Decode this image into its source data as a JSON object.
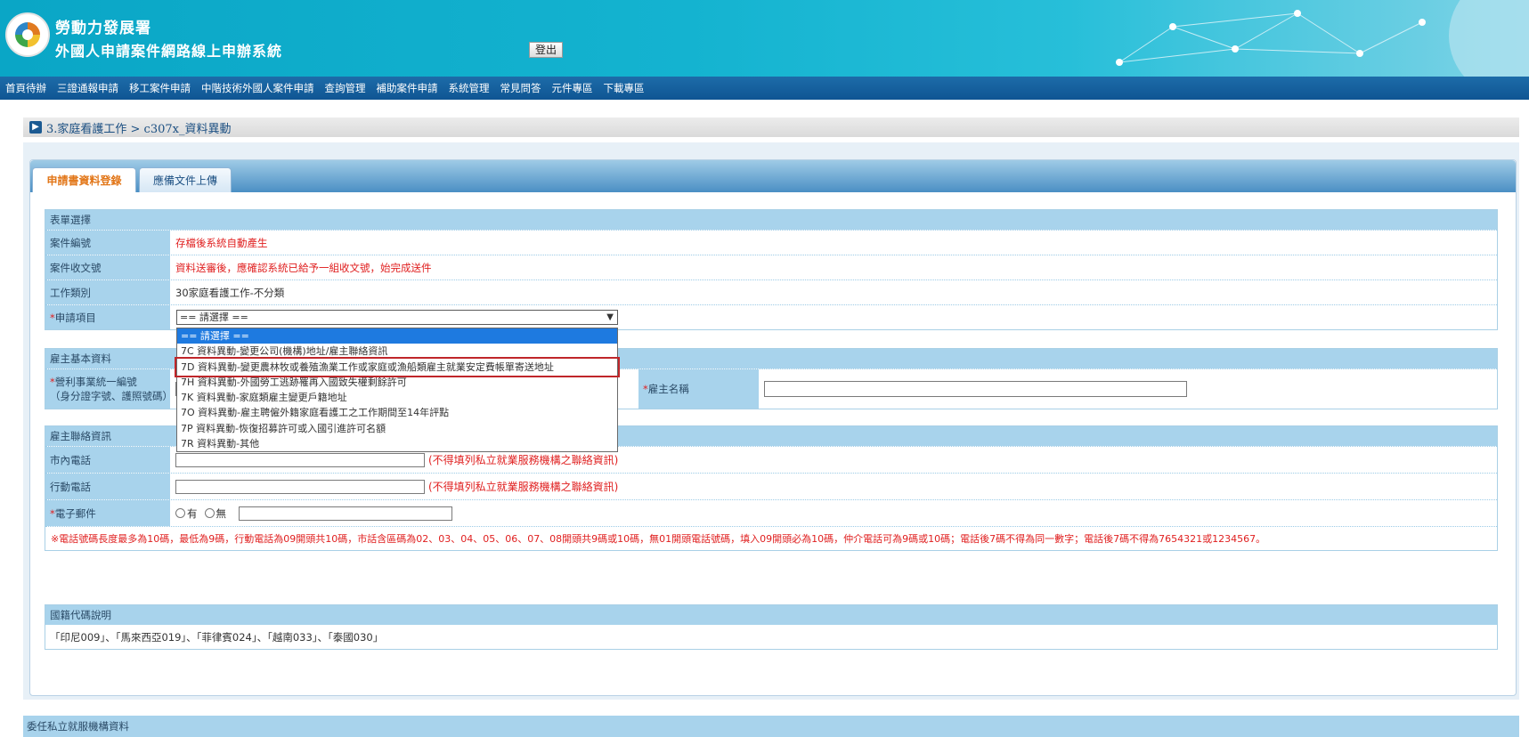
{
  "header": {
    "agency": "勞動力發展署",
    "system_title": "外國人申請案件網路線上申辦系統",
    "logout_label": "登出"
  },
  "menu": [
    "首頁待辦",
    "三證通報申請",
    "移工案件申請",
    "中階技術外國人案件申請",
    "查詢管理",
    "補助案件申請",
    "系統管理",
    "常見問答",
    "元件專區",
    "下載專區"
  ],
  "breadcrumb": "3.家庭看護工作 > c307x_資料異動",
  "tabs": {
    "active": "申請書資料登錄",
    "inactive": "應備文件上傳"
  },
  "form_select": {
    "heading": "表單選擇",
    "case_no_label": "案件編號",
    "case_no_value": "存檔後系統自動產生",
    "receipt_label": "案件收文號",
    "receipt_value": "資料送審後，應確認系統已給予一組收文號，始完成送件",
    "job_type_label": "工作類別",
    "job_type_value": "30家庭看護工作-不分類",
    "item_label": "申請項目",
    "item_selected": "== 請選擇 =="
  },
  "dropdown_options": [
    "== 請選擇 ==",
    "7C 資料異動-變更公司(機構)地址/雇主聯絡資訊",
    "7D 資料異動-變更農林牧或養殖漁業工作或家庭或漁船類雇主就業安定費帳單寄送地址",
    "7H 資料異動-外國勞工逃跡罹再入國致失權剩餘許可",
    "7K 資料異動-家庭類雇主變更戶籍地址",
    "7O 資料異動-雇主聘僱外籍家庭看護工之工作期間至14年評點",
    "7P 資料異動-恢復招募許可或入國引進許可名額",
    "7R 資料異動-其他"
  ],
  "employer_basic": {
    "heading": "雇主基本資料",
    "id_label": "營利事業統一編號",
    "id_sub": "（身分證字號、護照號碼）",
    "name_label": "雇主名稱"
  },
  "employer_contact": {
    "heading": "雇主聯絡資訊",
    "phone_label": "市內電話",
    "mobile_label": "行動電話",
    "phone_hint": "(不得填列私立就業服務機構之聯絡資訊)",
    "email_label": "電子郵件",
    "radio_yes": "有",
    "radio_no": "無",
    "note": "※電話號碼長度最多為10碼，最低為9碼，行動電話為09開頭共10碼，市話含區碼為02、03、04、05、06、07、08開頭共9碼或10碼，無01開頭電話號碼，填入09開頭必為10碼，仲介電話可為9碼或10碼；電話後7碼不得為同一數字；電話後7碼不得為7654321或1234567。"
  },
  "nationality": {
    "heading": "國籍代碼說明",
    "text": "「印尼009」、「馬來西亞019」、「菲律賓024」、「越南033」、「泰國030」"
  },
  "bottom_section": "委任私立就服機構資料"
}
